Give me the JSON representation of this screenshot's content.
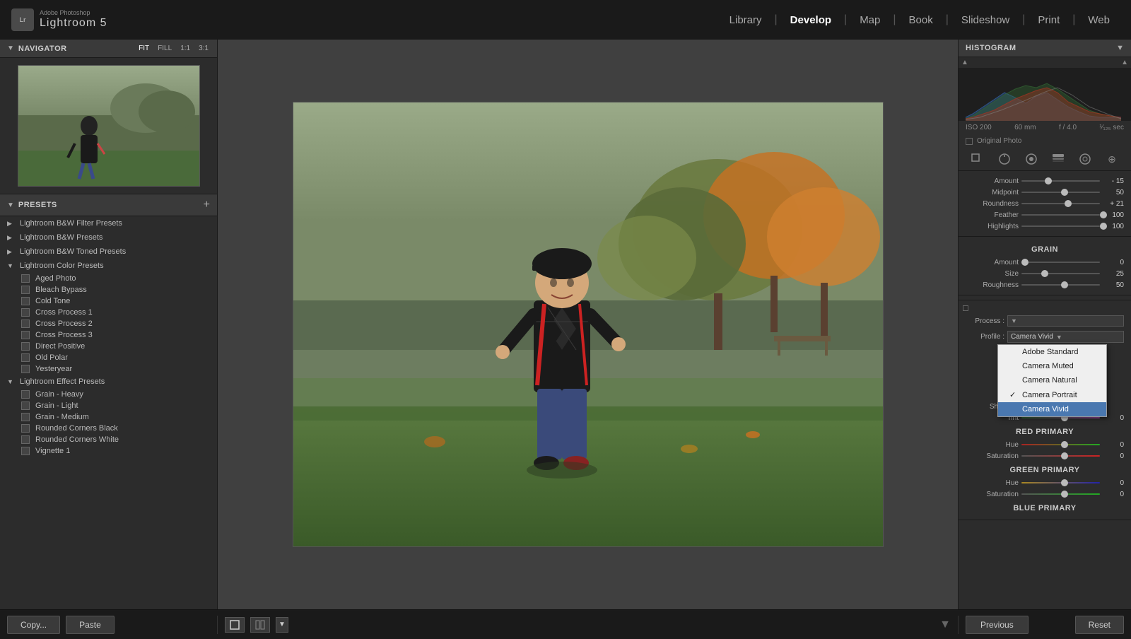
{
  "app": {
    "name": "Lightroom 5",
    "adobe_label": "Adobe Photoshop"
  },
  "topbar": {
    "logo_text": "Lr",
    "app_title": "Lightroom 5",
    "nav_items": [
      {
        "label": "Library",
        "active": false
      },
      {
        "label": "Develop",
        "active": true
      },
      {
        "label": "Map",
        "active": false
      },
      {
        "label": "Book",
        "active": false
      },
      {
        "label": "Slideshow",
        "active": false
      },
      {
        "label": "Print",
        "active": false
      },
      {
        "label": "Web",
        "active": false
      }
    ]
  },
  "left_panel": {
    "navigator": {
      "title": "Navigator",
      "fit_options": [
        "FIT",
        "FILL",
        "1:1",
        "3:1"
      ]
    },
    "presets": {
      "title": "Presets",
      "add_label": "+",
      "groups": [
        {
          "name": "Lightroom B&W Filter Presets",
          "expanded": false,
          "items": []
        },
        {
          "name": "Lightroom B&W Presets",
          "expanded": false,
          "items": []
        },
        {
          "name": "Lightroom B&W Toned Presets",
          "expanded": false,
          "items": []
        },
        {
          "name": "Lightroom Color Presets",
          "expanded": true,
          "items": [
            {
              "name": "Aged Photo"
            },
            {
              "name": "Bleach Bypass"
            },
            {
              "name": "Cold Tone"
            },
            {
              "name": "Cross Process 1"
            },
            {
              "name": "Cross Process 2"
            },
            {
              "name": "Cross Process 3"
            },
            {
              "name": "Direct Positive"
            },
            {
              "name": "Old Polar"
            },
            {
              "name": "Yesteryear"
            }
          ]
        },
        {
          "name": "Lightroom Effect Presets",
          "expanded": true,
          "items": [
            {
              "name": "Grain - Heavy"
            },
            {
              "name": "Grain - Light"
            },
            {
              "name": "Grain - Medium"
            },
            {
              "name": "Rounded Corners Black"
            },
            {
              "name": "Rounded Corners White"
            },
            {
              "name": "Vignette 1"
            }
          ]
        }
      ]
    }
  },
  "right_panel": {
    "histogram": {
      "title": "Histogram",
      "iso": "ISO 200",
      "focal": "60 mm",
      "aperture": "f / 4.0",
      "shutter": "¹⁄₁₂₅ sec",
      "original_photo_label": "Original Photo"
    },
    "adjustments": {
      "amount_label": "Amount",
      "amount_value": "- 15",
      "midpoint_label": "Midpoint",
      "midpoint_value": "50",
      "roundness_label": "Roundness",
      "roundness_value": "+ 21",
      "feather_label": "Feather",
      "feather_value": "100",
      "highlights_label": "Highlights",
      "highlights_value": "100"
    },
    "grain": {
      "title": "Grain",
      "amount_label": "Amount",
      "amount_value": "0",
      "size_label": "Size",
      "size_value": "25",
      "roughness_label": "Roughness",
      "roughness_value": "50"
    },
    "camera_calibration": {
      "process_label": "Process :",
      "profile_label": "Profile :",
      "shadows_label": "Shadows",
      "tint_label": "Tint",
      "tint_value": "0",
      "red_primary": {
        "title": "Red Primary",
        "hue_label": "Hue",
        "hue_value": "0",
        "sat_label": "Saturation",
        "sat_value": "0"
      },
      "green_primary": {
        "title": "Green Primary",
        "hue_label": "Hue",
        "hue_value": "0",
        "sat_label": "Saturation",
        "sat_value": "0"
      },
      "blue_primary_title": "Blue Primary"
    }
  },
  "profile_dropdown": {
    "items": [
      {
        "label": "Adobe Standard",
        "selected": false,
        "checked": false
      },
      {
        "label": "Camera Muted",
        "selected": false,
        "checked": false
      },
      {
        "label": "Camera Natural",
        "selected": false,
        "checked": false
      },
      {
        "label": "Camera Portrait",
        "selected": false,
        "checked": true
      },
      {
        "label": "Camera Vivid",
        "selected": true,
        "checked": false
      }
    ]
  },
  "bottombar": {
    "copy_label": "Copy...",
    "paste_label": "Paste",
    "previous_label": "Previous",
    "reset_label": "Reset"
  }
}
